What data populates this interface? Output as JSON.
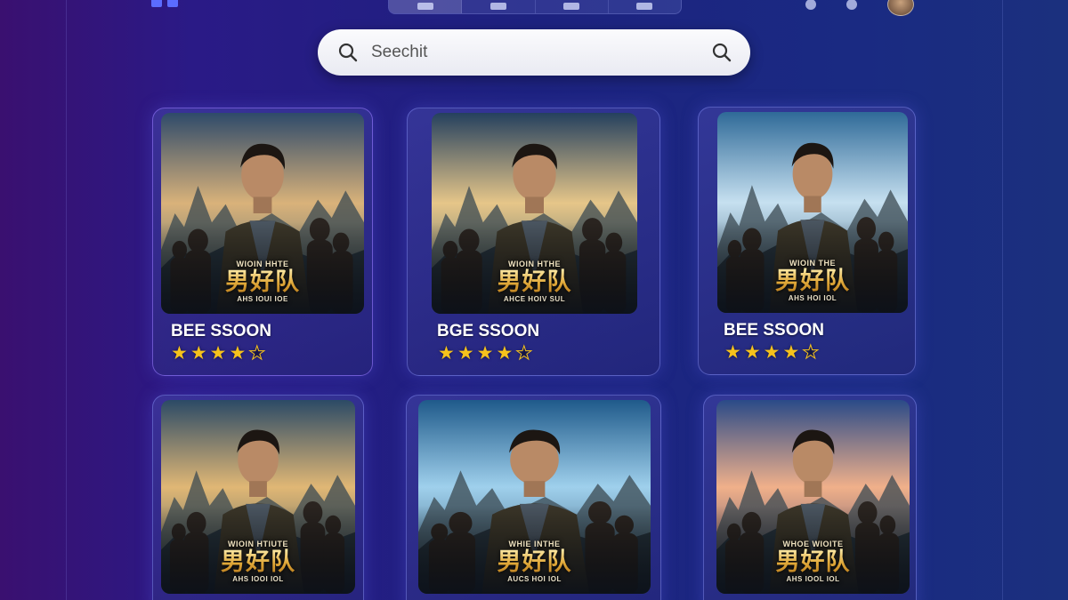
{
  "topbar": {
    "logo_icon": "app-logo-icon",
    "tabs": [
      {
        "icon": "home-icon"
      },
      {
        "icon": "tv-icon"
      },
      {
        "icon": "grid-icon"
      },
      {
        "icon": "library-icon"
      }
    ],
    "right_icons": [
      "bell-icon",
      "settings-icon",
      "user-avatar"
    ]
  },
  "search": {
    "placeholder": "Seechit",
    "left_icon": "search-icon",
    "right_icon": "search-icon"
  },
  "colors": {
    "accent": "#5b6cff",
    "star": "#f6c21c",
    "poster_title": "#e0a838"
  },
  "movies": [
    {
      "poster": {
        "top": "WIOIN HHTE",
        "title": "男好队",
        "sub": "AHS IOUI IOE"
      },
      "title": "BEE SSOON",
      "rating": 4
    },
    {
      "poster": {
        "top": "WIOIN HTHE",
        "title": "男好队",
        "sub": "AHCE HOIV SUL"
      },
      "title": "BGE SSOON",
      "rating": 4
    },
    {
      "poster": {
        "top": "WIOIN THE",
        "title": "男好队",
        "sub": "AHS HOI IOL"
      },
      "title": "BEE SSOON",
      "rating": 4
    },
    {
      "poster": {
        "top": "WIOIN HTIUTE",
        "title": "男好队",
        "sub": "AHS IOOI IOL"
      }
    },
    {
      "poster": {
        "top": "WHIE INTHE",
        "title": "男好队",
        "sub": "AUCS HOI IOL"
      }
    },
    {
      "poster": {
        "top": "WHOE WIOITE",
        "title": "男好队",
        "sub": "AHS IOOL IOL"
      }
    }
  ]
}
